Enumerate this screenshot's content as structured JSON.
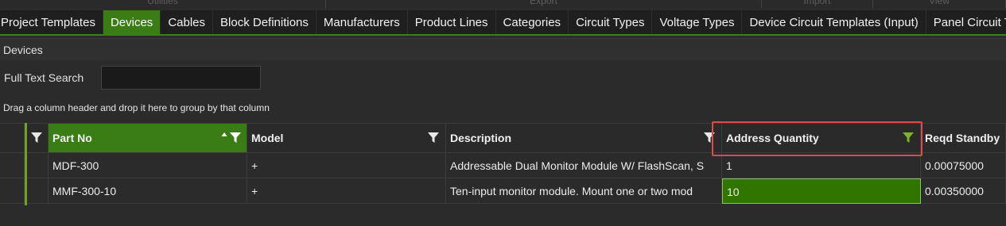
{
  "ribbon": {
    "groups": [
      {
        "label": "Utilities"
      },
      {
        "label": "Export"
      },
      {
        "label": "Import"
      },
      {
        "label": "View"
      }
    ]
  },
  "tabs": [
    {
      "label": "Project Templates",
      "active": false
    },
    {
      "label": "Devices",
      "active": true
    },
    {
      "label": "Cables",
      "active": false
    },
    {
      "label": "Block Definitions",
      "active": false
    },
    {
      "label": "Manufacturers",
      "active": false
    },
    {
      "label": "Product Lines",
      "active": false
    },
    {
      "label": "Categories",
      "active": false
    },
    {
      "label": "Circuit Types",
      "active": false
    },
    {
      "label": "Voltage Types",
      "active": false
    },
    {
      "label": "Device Circuit Templates (Input)",
      "active": false
    },
    {
      "label": "Panel Circuit Temp",
      "active": false
    }
  ],
  "section": {
    "title": "Devices"
  },
  "search": {
    "label": "Full Text Search",
    "value": "",
    "placeholder": ""
  },
  "group_panel": {
    "hint": "Drag a column header and drop it here to group by that column"
  },
  "grid": {
    "columns": [
      {
        "label": "Part No"
      },
      {
        "label": "Model"
      },
      {
        "label": "Description"
      },
      {
        "label": "Address Quantity"
      },
      {
        "label": "Reqd Standby"
      }
    ],
    "rows": [
      {
        "part_no": "MDF-300",
        "model": "+",
        "description": "Addressable Dual Monitor Module W/ FlashScan, S",
        "address_quantity": "1",
        "reqd_standby": "0.00075000"
      },
      {
        "part_no": "MMF-300-10",
        "model": "+",
        "description": "Ten-input monitor module. Mount one or two mod",
        "address_quantity": "10",
        "reqd_standby": "0.00350000"
      }
    ]
  },
  "colors": {
    "accent": "#3a7d15",
    "active_filter": "#7db52a",
    "highlight": "#e24848"
  }
}
